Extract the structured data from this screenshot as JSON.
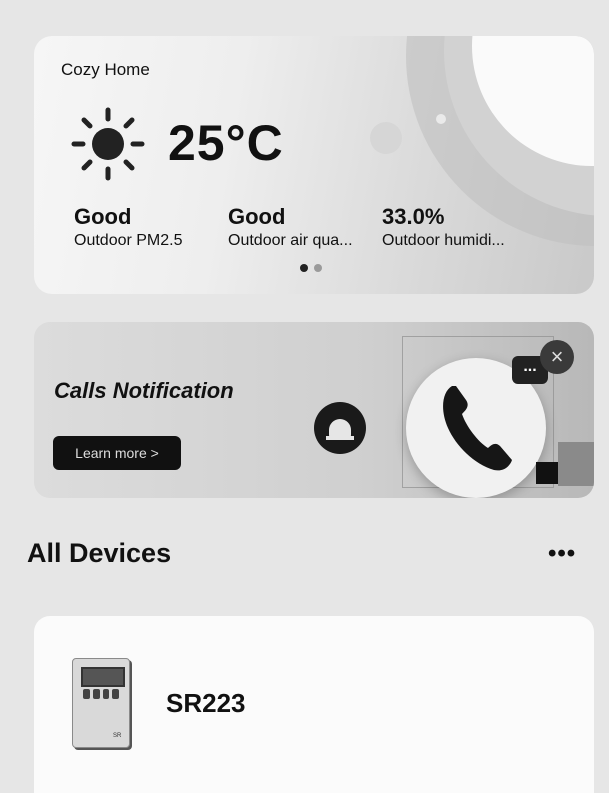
{
  "weather": {
    "title": "Cozy Home",
    "temperature": "25°C",
    "icon": "sun-icon",
    "metrics": [
      {
        "value": "Good",
        "label": "Outdoor PM2.5"
      },
      {
        "value": "Good",
        "label": "Outdoor air qua..."
      },
      {
        "value": "33.0%",
        "label": "Outdoor humidi..."
      }
    ],
    "pager": {
      "pages": 2,
      "active": 1
    }
  },
  "banner": {
    "title": "Calls Notification",
    "button_label": "Learn more >",
    "icons": [
      "siren-icon",
      "phone-icon",
      "chat-bubble-icon",
      "close-icon"
    ],
    "chat_text": "...",
    "close_text": "×"
  },
  "devices": {
    "title": "All Devices",
    "more_label": "•••",
    "items": [
      {
        "name": "SR223",
        "icon": "controller-device-icon",
        "tag": "SR"
      }
    ]
  }
}
